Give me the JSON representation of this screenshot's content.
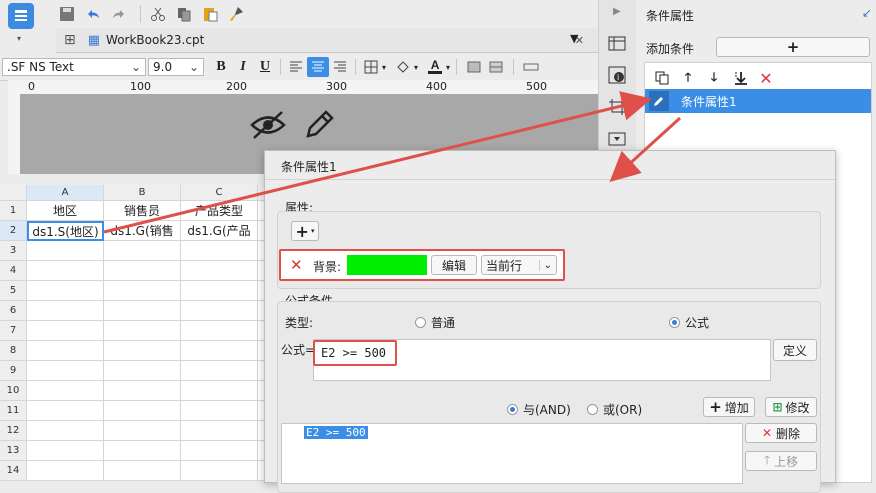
{
  "tab": {
    "title": "WorkBook23.cpt"
  },
  "format": {
    "font": ".SF NS Text",
    "size": "9.0",
    "bold": "B",
    "italic": "I",
    "underline": "U"
  },
  "ruler": {
    "ticks": [
      "0",
      "100",
      "200",
      "300",
      "400",
      "500"
    ]
  },
  "grid": {
    "columns": [
      "A",
      "B",
      "C"
    ],
    "rows": [
      "1",
      "2",
      "3",
      "4",
      "5",
      "6",
      "7",
      "8",
      "9",
      "10",
      "11",
      "12",
      "13",
      "14"
    ],
    "row1": [
      "地区",
      "销售员",
      "产品类型"
    ],
    "row2": [
      "ds1.S(地区)",
      "ds1.G(销售",
      "ds1.G(产品"
    ]
  },
  "right_panel": {
    "title": "条件属性",
    "add_condition": "添加条件",
    "add_symbol": "+",
    "item": "条件属性1"
  },
  "dialog": {
    "title": "条件属性1",
    "attr_label": "属性:",
    "bg_label": "背景:",
    "edit": "编辑",
    "scope": "当前行",
    "formula_group": "公式条件",
    "type_label": "类型:",
    "type_normal": "普通",
    "type_formula": "公式",
    "formula_label": "公式=",
    "formula_value": "E2 >= 500",
    "define": "定义",
    "and": "与(AND)",
    "or": "或(OR)",
    "add": "增加",
    "modify": "修改",
    "delete": "删除",
    "move_up": "上移",
    "list_item": "E2 >= 500"
  },
  "colors": {
    "accent": "#3a8ee6",
    "bg_swatch": "#00ee00",
    "highlight": "#e0504a"
  }
}
